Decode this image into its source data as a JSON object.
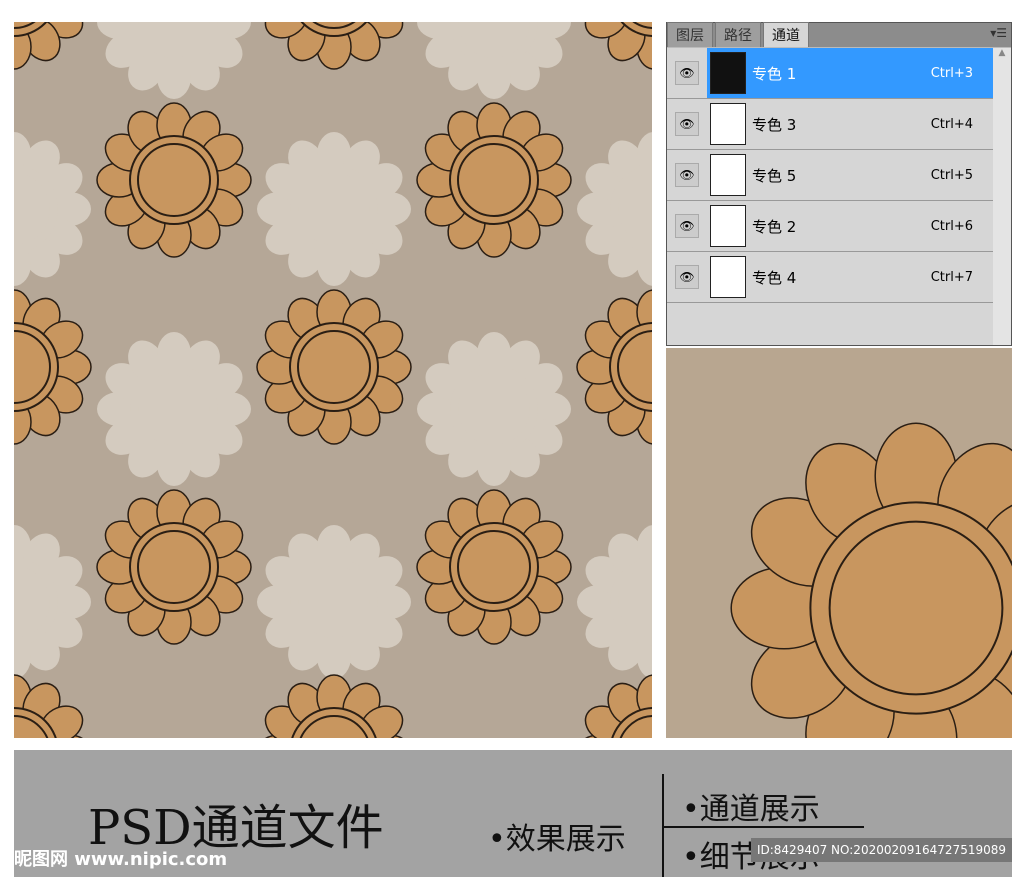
{
  "panel": {
    "tabs": [
      "图层",
      "路径",
      "通道"
    ],
    "active_tab": 2,
    "menu_icon": "panel-menu-icon",
    "channels": [
      {
        "name": "专色 1",
        "shortcut": "Ctrl+3",
        "selected": true
      },
      {
        "name": "专色 3",
        "shortcut": "Ctrl+4",
        "selected": false
      },
      {
        "name": "专色 5",
        "shortcut": "Ctrl+5",
        "selected": false
      },
      {
        "name": "专色 2",
        "shortcut": "Ctrl+6",
        "selected": false
      },
      {
        "name": "专色 4",
        "shortcut": "Ctrl+7",
        "selected": false
      }
    ]
  },
  "band": {
    "title": "PSD通道文件",
    "effect": "•效果展示",
    "channel": "•通道展示",
    "detail": "•细节展示",
    "watermark": "昵图网 www.nipic.com",
    "id": "ID:8429407 NO:20200209164727519089"
  },
  "colors": {
    "flower": "#c8965f",
    "bg": "#b5a797",
    "select": "#3399ff"
  }
}
